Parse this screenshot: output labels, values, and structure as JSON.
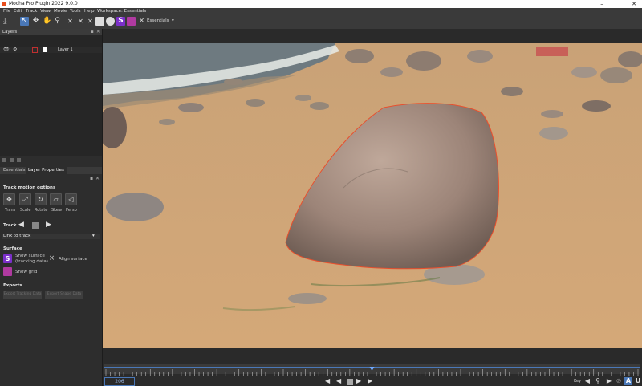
{
  "window": {
    "title": "Mocha Pro Plugin 2022 9.0.0"
  },
  "menu": [
    "File",
    "Edit",
    "Track",
    "View",
    "Movie",
    "Tools",
    "Help",
    "Workspace: Essentials"
  ],
  "workspace": {
    "label": "Essentials"
  },
  "layers_panel": {
    "header": "Layers",
    "layer_name": "Layer 1"
  },
  "tabs": [
    "Essentials",
    "Layer Properties"
  ],
  "track_motion": {
    "title": "Track motion options",
    "options": [
      "Trans",
      "Scale",
      "Rotate",
      "Skew",
      "Persp"
    ]
  },
  "track": {
    "label": "Track"
  },
  "link": {
    "label": "Link to track"
  },
  "surface": {
    "title": "Surface",
    "show_surface_line1": "Show surface",
    "show_surface_line2": "(tracking data)",
    "align_surface": "Align surface",
    "show_grid": "Show grid"
  },
  "exports": {
    "title": "Exports",
    "export_tracking": "Export Tracking Data",
    "export_shape": "Export Shape Data"
  },
  "timeline": {
    "frame": "206",
    "key_label": "Key",
    "playhead_fraction": 0.5
  },
  "colors": {
    "accent": "#4a78b8",
    "spline": "#e8502e",
    "surface": "#7b2fc9",
    "grid": "#b03aa0"
  }
}
